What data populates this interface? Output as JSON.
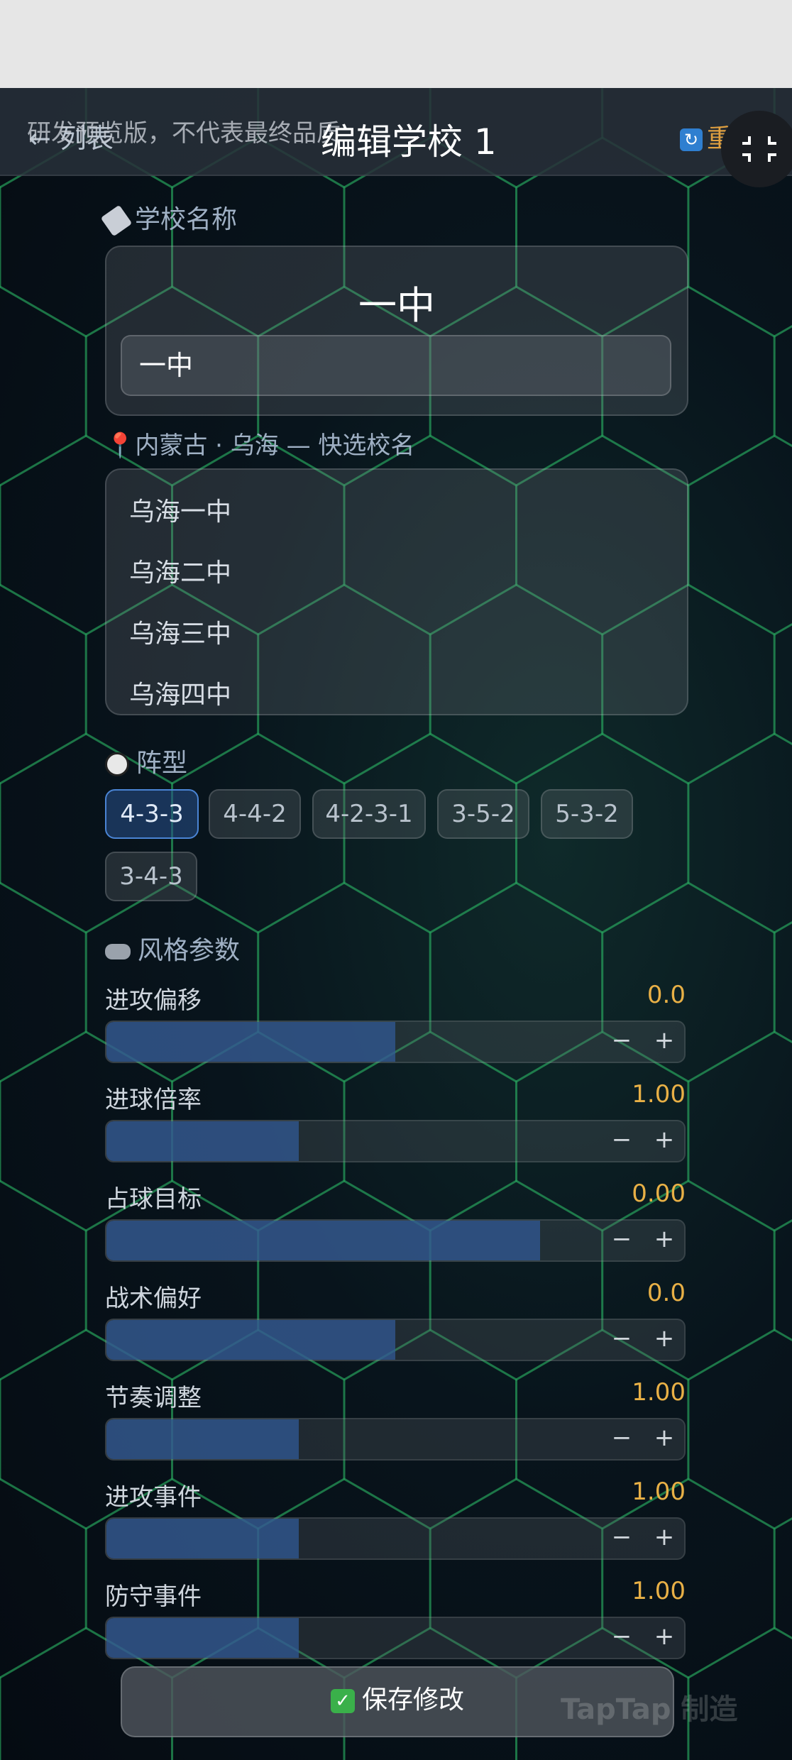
{
  "header": {
    "back_label": "← 列表",
    "notice": "研发预览版，不代表最终品质",
    "title": "编辑学校 1",
    "reset_label": "重置"
  },
  "school_name": {
    "label": "学校名称",
    "display": "一中",
    "input_value": "一中"
  },
  "quick": {
    "label": "内蒙古 · 乌海 — 快选校名",
    "items": [
      "乌海一中",
      "乌海二中",
      "乌海三中",
      "乌海四中"
    ]
  },
  "formation": {
    "label": "阵型",
    "options": [
      "4-3-3",
      "4-4-2",
      "4-2-3-1",
      "3-5-2",
      "5-3-2",
      "3-4-3"
    ],
    "selected": "4-3-3"
  },
  "style": {
    "label": "风格参数",
    "params": [
      {
        "label": "进攻偏移",
        "value": "0.0",
        "fill": 0.5
      },
      {
        "label": "进球倍率",
        "value": "1.00",
        "fill": 0.333
      },
      {
        "label": "占球目标",
        "value": "0.00",
        "fill": 0.75
      },
      {
        "label": "战术偏好",
        "value": "0.0",
        "fill": 0.5
      },
      {
        "label": "节奏调整",
        "value": "1.00",
        "fill": 0.333
      },
      {
        "label": "进攻事件",
        "value": "1.00",
        "fill": 0.333
      },
      {
        "label": "防守事件",
        "value": "1.00",
        "fill": 0.333
      }
    ]
  },
  "save_label": "保存修改",
  "watermark": "TapTap 制造",
  "colors": {
    "accent": "#4a84d4",
    "value": "#e8b046",
    "reset": "#e0a040"
  }
}
